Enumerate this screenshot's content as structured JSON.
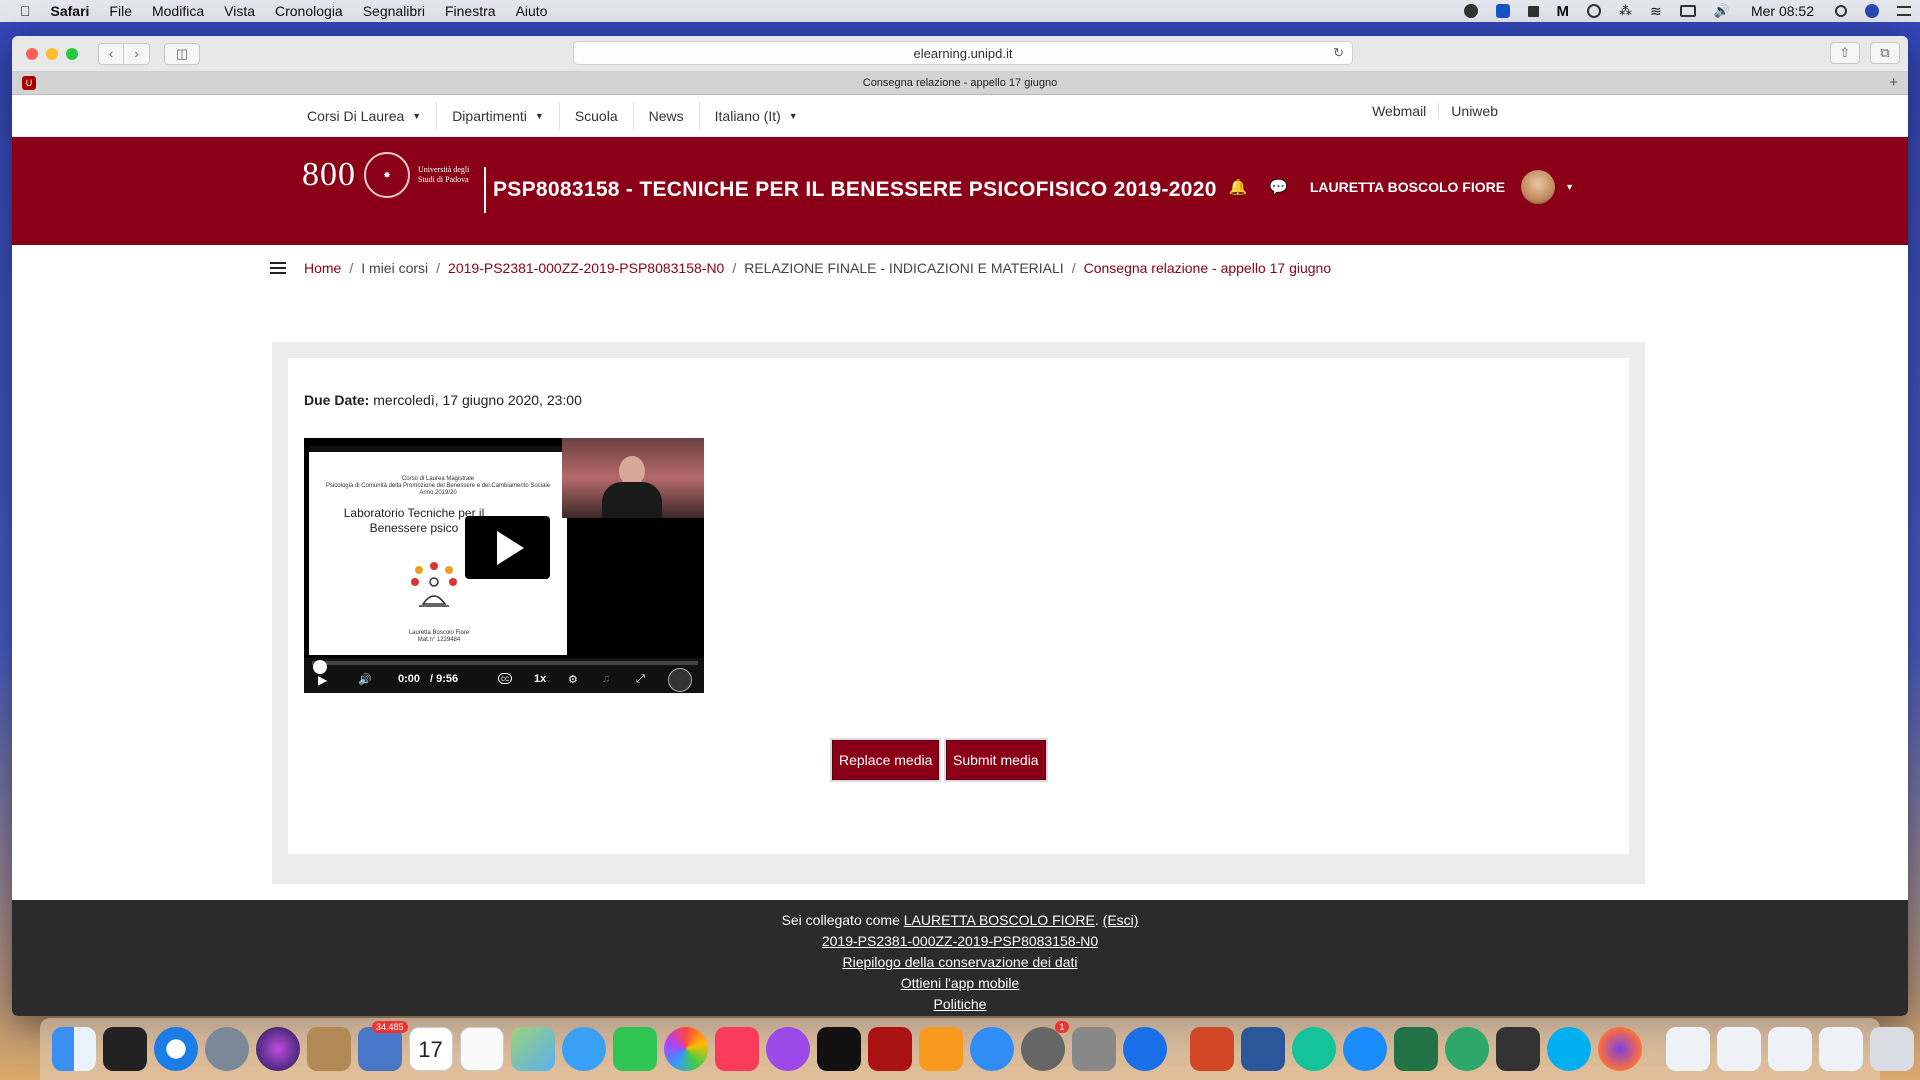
{
  "menubar": {
    "app": "Safari",
    "items": [
      "File",
      "Modifica",
      "Vista",
      "Cronologia",
      "Segnalibri",
      "Finestra",
      "Aiuto"
    ],
    "clock": "Mer 08:52"
  },
  "browser": {
    "url": "elearning.unipd.it",
    "tab_title": "Consegna relazione - appello 17 giugno"
  },
  "topnav": {
    "items": [
      "Corsi Di Laurea",
      "Dipartimenti",
      "Scuola",
      "News",
      "Italiano (It)"
    ],
    "right_links": [
      "Webmail",
      "Uniweb"
    ]
  },
  "banner": {
    "logo_number": "800",
    "logo_text": "Università degli Studi di Padova",
    "course_title": "PSP8083158 - TECNICHE PER IL BENESSERE PSICOFISICO 2019-2020",
    "user_name": "LAURETTA BOSCOLO FIORE"
  },
  "breadcrumb": [
    "Home",
    "I miei corsi",
    "2019-PS2381-000ZZ-2019-PSP8083158-N0",
    "RELAZIONE FINALE - INDICAZIONI E MATERIALI",
    "Consegna relazione - appello 17 giugno"
  ],
  "assignment": {
    "due_label": "Due Date:",
    "due_value": "mercoledì, 17 giugno 2020, 23:00"
  },
  "video": {
    "slide_header": "Corso di Laurea Magistrale\nPsicologia di Comunità della Promozione del Benessere e del Cambiamento Sociale\nAnno 2019/20",
    "slide_title": "Laboratorio Tecniche per il Benessere psico",
    "slide_author": "Lauretta Boscolo Fiore\nMat.n° 1229484",
    "time_current": "0:00",
    "time_total": "/ 9:56",
    "speed": "1x",
    "progress": 0
  },
  "buttons": {
    "replace": "Replace media",
    "submit": "Submit media"
  },
  "footer": {
    "logged_prefix": "Sei collegato come",
    "logged_user": "LAURETTA BOSCOLO FIORE",
    "logout": "(Esci)",
    "course_link": "2019-PS2381-000ZZ-2019-PSP8083158-N0",
    "data_retention": "Riepilogo della conservazione dei dati",
    "mobile_app": "Ottieni l'app mobile",
    "policies": "Politiche"
  },
  "dock": {
    "badges": [
      "34.485",
      "1"
    ]
  },
  "colors": {
    "brand": "#8b0017",
    "footer_bg": "#2b2b2b"
  }
}
